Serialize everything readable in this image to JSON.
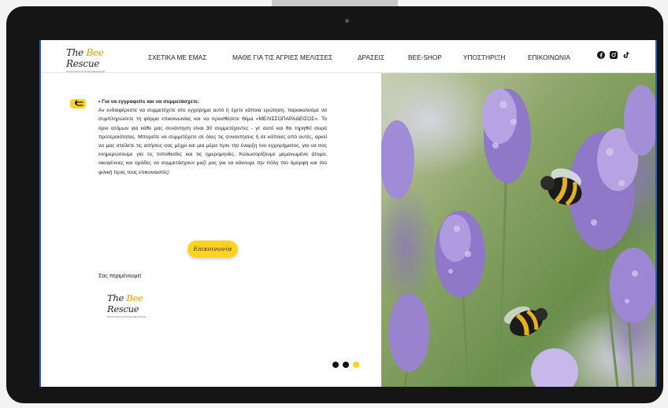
{
  "nav": {
    "logo_text_a": "The ",
    "logo_text_b": "Bee",
    "logo_text_c": " Rescue",
    "logo_subtitle": "ΠΡΟΣΤΑΣΙΑ ΑΓΡΙΩΝ ΜΕΛΙΣΣΩΝ",
    "links": [
      "ΣΧΕΤΙΚΑ ΜΕ ΕΜΑΣ",
      "ΜΑΘΕ ΓΙΑ ΤΙΣ ΑΓΡΙΕΣ ΜΕΛΙΣΣΕΣ",
      "ΔΡΑΣΕΙΣ",
      "BEE-SHOP",
      "ΥΠΟΣΤΗΡΙΞΗ",
      "ΕΠΙΚΟΙΝΩΝΙΑ"
    ],
    "social_icons": [
      "facebook-icon",
      "instagram-icon",
      "tiktok-icon"
    ]
  },
  "content": {
    "heading": "• Για να εγγραφείτε και να συμμετάσχετε:",
    "body": "Αν ενδιαφέρεστε να συμμετέχετε στο εγχείρημα αυτό ή έχετε κάποια ερώτηση, παρακαλούμε να συμπληρώσετε τη φόρμα επικοινωνίας και να προσθέσετε θέμα «ΜΕΛΙΣΣΟΠΑΡΑΔΕΙΣΟΣ». Το όριο ατόμων για κάθε μας συνάντηση είναι 30 συμμετέχοντες - γι' αυτό και θα τηρηθεί σειρά προτεραιότητας. Μπορείτε να συμμετέχετε σε όλες τις συναντήσεις ή σε κάποιες από αυτές, αρκεί να μας στείλετε τις αιτήσεις σας μέχρι και μια μέρα πριν την έναρξη του εγχειρήματος, για να σας ενημερώσουμε για τις τοποθεσίες και τις ημερομηνίες. Καλωσορίζουμε μεμονωμένα άτομα, οικογένειες και ομάδες να συμμετάσχουν μαζί μας για να κάνουμε την πόλη πιο όμορφη και πιο φιλική προς τους επικονιαστές!",
    "cta_label": "Επικοινωνία",
    "closing": "Σας περιμένουμε!",
    "back_icon": "back-arrow-icon",
    "slider": {
      "count": 3,
      "active_index": 2
    }
  },
  "colors": {
    "accent": "#ffd21f",
    "frame_border": "#2b5fb5",
    "dot_inactive": "#111111"
  }
}
